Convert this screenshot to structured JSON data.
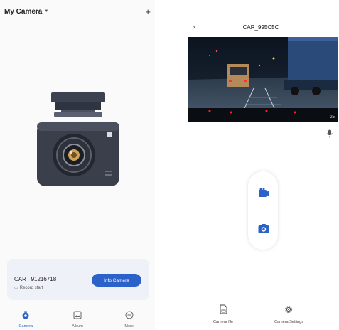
{
  "left": {
    "title": "My Camera",
    "camera": {
      "name": "CAR _91216718",
      "status": "Record start",
      "info_button": "Info Camera"
    },
    "nav": [
      {
        "label": "Camera",
        "icon": "camera-icon",
        "active": true
      },
      {
        "label": "Album",
        "icon": "album-icon",
        "active": false
      },
      {
        "label": "More",
        "icon": "more-icon",
        "active": false
      }
    ]
  },
  "right": {
    "title": "CAR_995C5C",
    "video_timestamp": "25",
    "nav": [
      {
        "label": "Camera file",
        "icon": "sd-card-icon"
      },
      {
        "label": "Camera Settings",
        "icon": "gear-icon"
      }
    ]
  },
  "colors": {
    "accent": "#2a62c9",
    "card_bg": "#eef2f8"
  }
}
